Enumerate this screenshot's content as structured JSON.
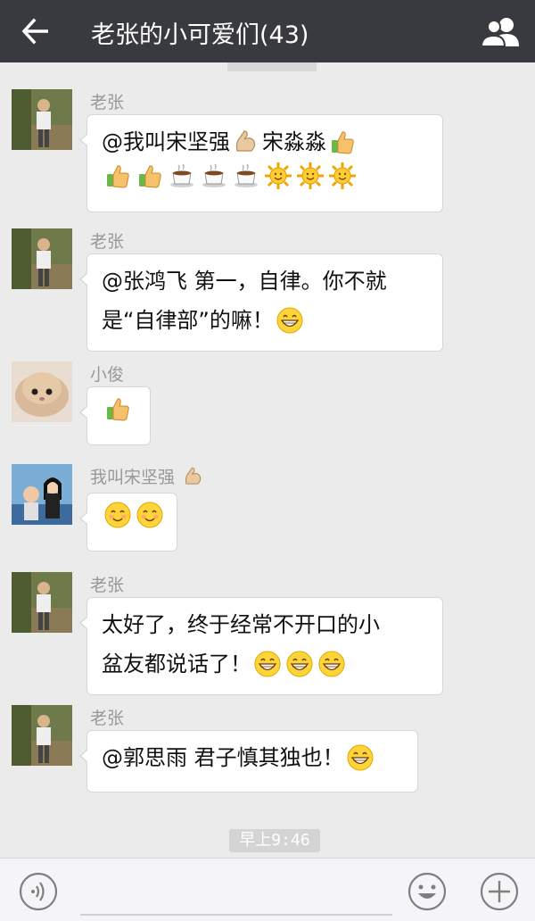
{
  "header": {
    "title": "老张的小可爱们(43)",
    "back_icon": "back-arrow-icon",
    "members_icon": "group-members-icon"
  },
  "messages": [
    {
      "sender": "老张",
      "lines": [
        [
          "@我叫宋坚强 ",
          "emo:strong",
          "宋淼淼 ",
          "emo:thumbsup"
        ],
        [
          "emo:thumbsup",
          "emo:thumbsup",
          "emo:coffee",
          "emo:coffee",
          "emo:coffee",
          "emo:sun",
          "emo:sun",
          "emo:sun"
        ]
      ]
    },
    {
      "sender": "老张",
      "lines": [
        [
          "@张鸿飞 第一，自律。你不就"
        ],
        [
          "是“自律部”的嘛！",
          "emo:grin"
        ]
      ]
    },
    {
      "sender": "小俊",
      "lines": [
        [
          "emo:thumbsup"
        ]
      ]
    },
    {
      "sender": "我叫宋坚强",
      "sender_emoji": "emo:strong",
      "lines": [
        [
          "emo:smile",
          "emo:smile"
        ]
      ]
    },
    {
      "sender": "老张",
      "lines": [
        [
          "太好了，终于经常不开口的小"
        ],
        [
          "盆友都说话了！",
          "emo:grin",
          "emo:grin",
          "emo:grin"
        ]
      ]
    },
    {
      "sender": "老张",
      "lines": [
        [
          "@郭思雨 君子慎其独也！",
          "emo:grin"
        ]
      ]
    }
  ],
  "timestamp": "早上9:46",
  "input_bar": {
    "voice_icon": "voice-icon",
    "emoji_icon": "emoji-icon",
    "plus_icon": "plus-icon"
  },
  "colors": {
    "header_bg": "#393a3f",
    "chat_bg": "#ebebeb",
    "bubble_bg": "#ffffff",
    "sender_text": "#999999"
  }
}
